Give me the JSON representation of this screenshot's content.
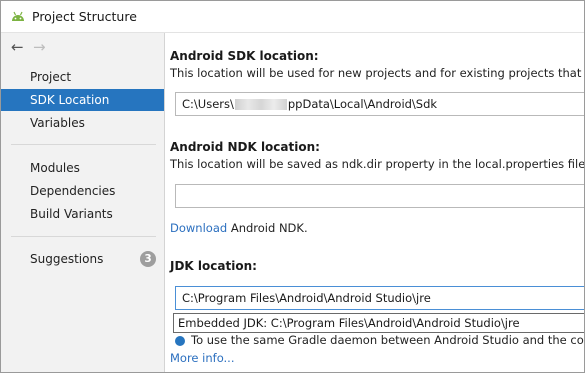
{
  "window": {
    "title": "Project Structure"
  },
  "sidebar": {
    "items": [
      {
        "label": "Project"
      },
      {
        "label": "SDK Location"
      },
      {
        "label": "Variables"
      },
      {
        "label": "Modules"
      },
      {
        "label": "Dependencies"
      },
      {
        "label": "Build Variants"
      },
      {
        "label": "Suggestions",
        "badge": "3"
      }
    ]
  },
  "sdk": {
    "heading": "Android SDK location:",
    "description": "This location will be used for new projects and for existing projects that do not",
    "path_prefix": "C:\\Users\\",
    "path_suffix": "ppData\\Local\\Android\\Sdk"
  },
  "ndk": {
    "heading": "Android NDK location:",
    "description": "This location will be saved as ndk.dir property in the local.properties file.",
    "path": "",
    "download_link": "Download",
    "download_rest": " Android NDK."
  },
  "jdk": {
    "heading": "JDK location:",
    "path": "C:\\Program Files\\Android\\Android Studio\\jre",
    "suggestion": "Embedded JDK: C:\\Program Files\\Android\\Android Studio\\jre",
    "partial_line": "To use the same Gradle daemon between Android Studio and the comman",
    "more_info": "More info..."
  },
  "colors": {
    "selection": "#2675bf",
    "link": "#2b6fbf"
  }
}
